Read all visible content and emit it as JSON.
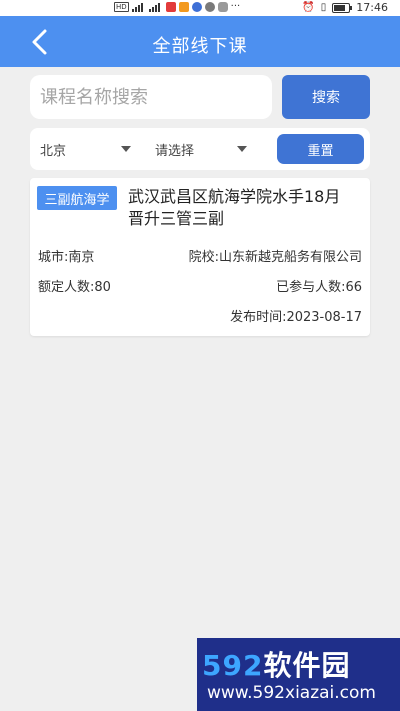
{
  "status_bar": {
    "time": "17:46"
  },
  "header": {
    "title": "全部线下课"
  },
  "search": {
    "placeholder": "课程名称搜索",
    "value": "",
    "button_label": "搜索"
  },
  "filters": {
    "city": "北京",
    "school": "请选择",
    "reset_label": "重置"
  },
  "courses": [
    {
      "tag": "三副航海学",
      "title": "武汉武昌区航海学院水手18月晋升三管三副",
      "city_label": "城市:南京",
      "school_label": "院校:山东新越克船务有限公司",
      "quota_label": "额定人数:80",
      "joined_label": "已参与人数:66",
      "publish_label": "发布时间:2023-08-17"
    }
  ],
  "watermark": {
    "logo_num": "592",
    "logo_text": "软件园",
    "url": "www.592xiazai.com"
  },
  "colors": {
    "header_bg": "#4d90f0",
    "button_bg": "#3f74d4",
    "page_bg": "#efefef"
  }
}
